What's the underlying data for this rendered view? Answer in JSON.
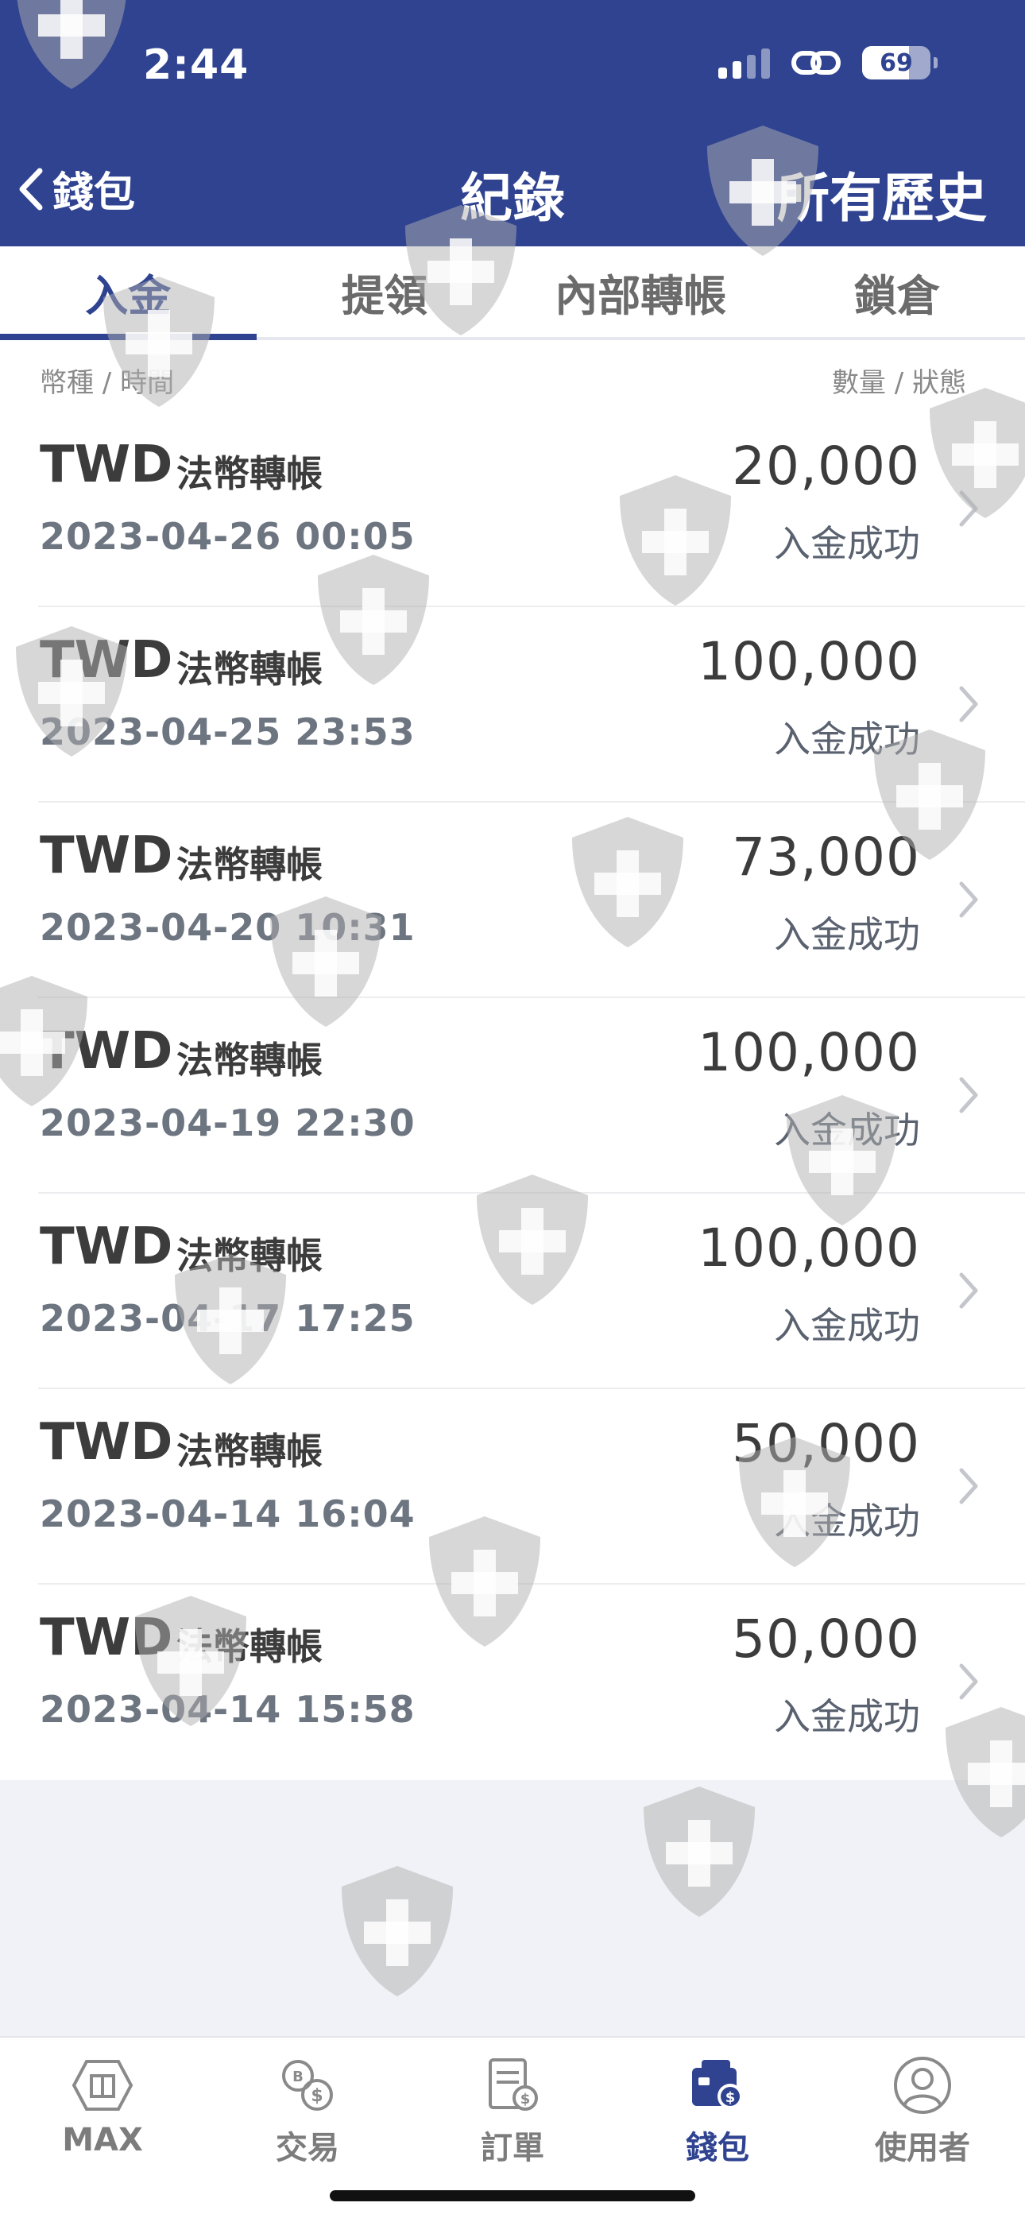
{
  "status_bar": {
    "time": "2:44",
    "battery": "69",
    "battery_level": 0.69
  },
  "nav": {
    "back_label": "錢包",
    "title": "紀錄",
    "right_action": "所有歷史"
  },
  "tabs": [
    {
      "label": "入金",
      "active": true
    },
    {
      "label": "提領",
      "active": false
    },
    {
      "label": "內部轉帳",
      "active": false
    },
    {
      "label": "鎖倉",
      "active": false
    }
  ],
  "columns": {
    "left": "幣種 / 時間",
    "right": "數量 / 狀態"
  },
  "records": [
    {
      "currency": "TWD",
      "type": "法幣轉帳",
      "datetime": "2023-04-26 00:05",
      "amount": "20,000",
      "status": "入金成功"
    },
    {
      "currency": "TWD",
      "type": "法幣轉帳",
      "datetime": "2023-04-25 23:53",
      "amount": "100,000",
      "status": "入金成功"
    },
    {
      "currency": "TWD",
      "type": "法幣轉帳",
      "datetime": "2023-04-20 10:31",
      "amount": "73,000",
      "status": "入金成功"
    },
    {
      "currency": "TWD",
      "type": "法幣轉帳",
      "datetime": "2023-04-19 22:30",
      "amount": "100,000",
      "status": "入金成功"
    },
    {
      "currency": "TWD",
      "type": "法幣轉帳",
      "datetime": "2023-04-17 17:25",
      "amount": "100,000",
      "status": "入金成功"
    },
    {
      "currency": "TWD",
      "type": "法幣轉帳",
      "datetime": "2023-04-14 16:04",
      "amount": "50,000",
      "status": "入金成功"
    },
    {
      "currency": "TWD",
      "type": "法幣轉帳",
      "datetime": "2023-04-14 15:58",
      "amount": "50,000",
      "status": "入金成功"
    }
  ],
  "tabbar": [
    {
      "label": "MAX",
      "icon": "max-logo-icon",
      "active": false
    },
    {
      "label": "交易",
      "icon": "exchange-icon",
      "active": false
    },
    {
      "label": "訂單",
      "icon": "orders-icon",
      "active": false
    },
    {
      "label": "錢包",
      "icon": "wallet-icon",
      "active": true
    },
    {
      "label": "使用者",
      "icon": "user-icon",
      "active": false
    }
  ],
  "colors": {
    "brand": "#2f4391",
    "background": "#f1f2f7",
    "muted_text": "#6d7580"
  }
}
